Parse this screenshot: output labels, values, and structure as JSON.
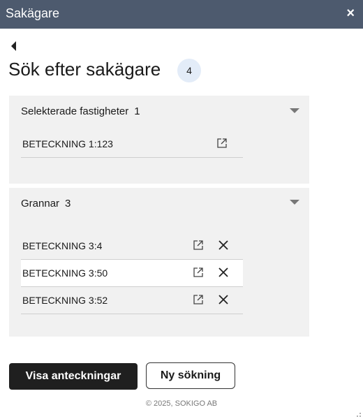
{
  "window": {
    "title": "Sakägare",
    "close_label": "×"
  },
  "page": {
    "heading": "Sök efter sakägare",
    "count": "4"
  },
  "selected": {
    "title": "Selekterade fastigheter",
    "count": "1",
    "items": [
      {
        "label": "BETECKNING 1:123"
      }
    ]
  },
  "neighbors": {
    "title": "Grannar",
    "count": "3",
    "items": [
      {
        "label": "BETECKNING 3:4"
      },
      {
        "label": "BETECKNING 3:50"
      },
      {
        "label": "BETECKNING 3:52"
      }
    ]
  },
  "actions": {
    "show_notes": "Visa anteckningar",
    "new_search": "Ny sökning"
  },
  "footer": {
    "copyright": "© 2025, SOKIGO AB"
  },
  "icons": {
    "back": "caret-left-icon",
    "open": "external-link-icon",
    "remove": "close-x-icon",
    "expand": "caret-down-icon"
  },
  "colors": {
    "titlebar": "#4d5a6e",
    "panel": "#f1f1f1",
    "badge": "#e3ecf8",
    "primary_button": "#1f1f1f"
  }
}
